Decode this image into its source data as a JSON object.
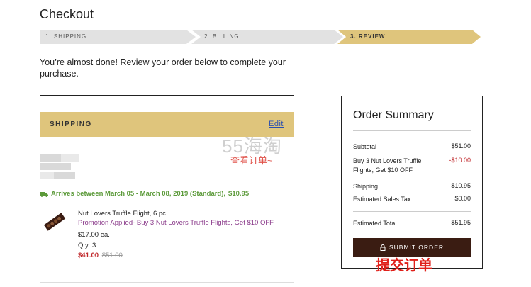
{
  "page_title": "Checkout",
  "steps": [
    {
      "label": "1. SHIPPING"
    },
    {
      "label": "2. BILLING"
    },
    {
      "label": "3. REVIEW"
    }
  ],
  "intro_text": "You’re almost done! Review your order below to complete your purchase.",
  "shipping": {
    "title": "SHIPPING",
    "edit_label": "Edit",
    "arrival": "Arrives between March 05 - March 08, 2019 (Standard),",
    "arrival_price": "$10.95"
  },
  "watermark": {
    "text": "55海淘",
    "sub": "查看订单~"
  },
  "product": {
    "name": "Nut Lovers Truffle Flight, 6 pc.",
    "promo": "Promotion Applied- Buy 3 Nut Lovers Truffle Flights, Get $10 OFF",
    "each": "$17.00 ea.",
    "qty": "Qty: 3",
    "price": "$41.00",
    "old_price": "$51.00"
  },
  "summary": {
    "title": "Order Summary",
    "subtotal_label": "Subtotal",
    "subtotal_value": "$51.00",
    "promo_label": "Buy 3 Nut Lovers Truffle Flights, Get $10 OFF",
    "promo_value": "-$10.00",
    "shipping_label": "Shipping",
    "shipping_value": "$10.95",
    "tax_label": "Estimated Sales Tax",
    "tax_value": "$0.00",
    "total_label": "Estimated Total",
    "total_value": "$51.95",
    "submit_label": "SUBMIT ORDER"
  },
  "annotation": "提交订单",
  "colors": {
    "accent": "#dfc57c",
    "button": "#3a1c12",
    "promo": "#8a3a8a",
    "sale": "#c0282b",
    "arrival": "#5c9a3a"
  }
}
